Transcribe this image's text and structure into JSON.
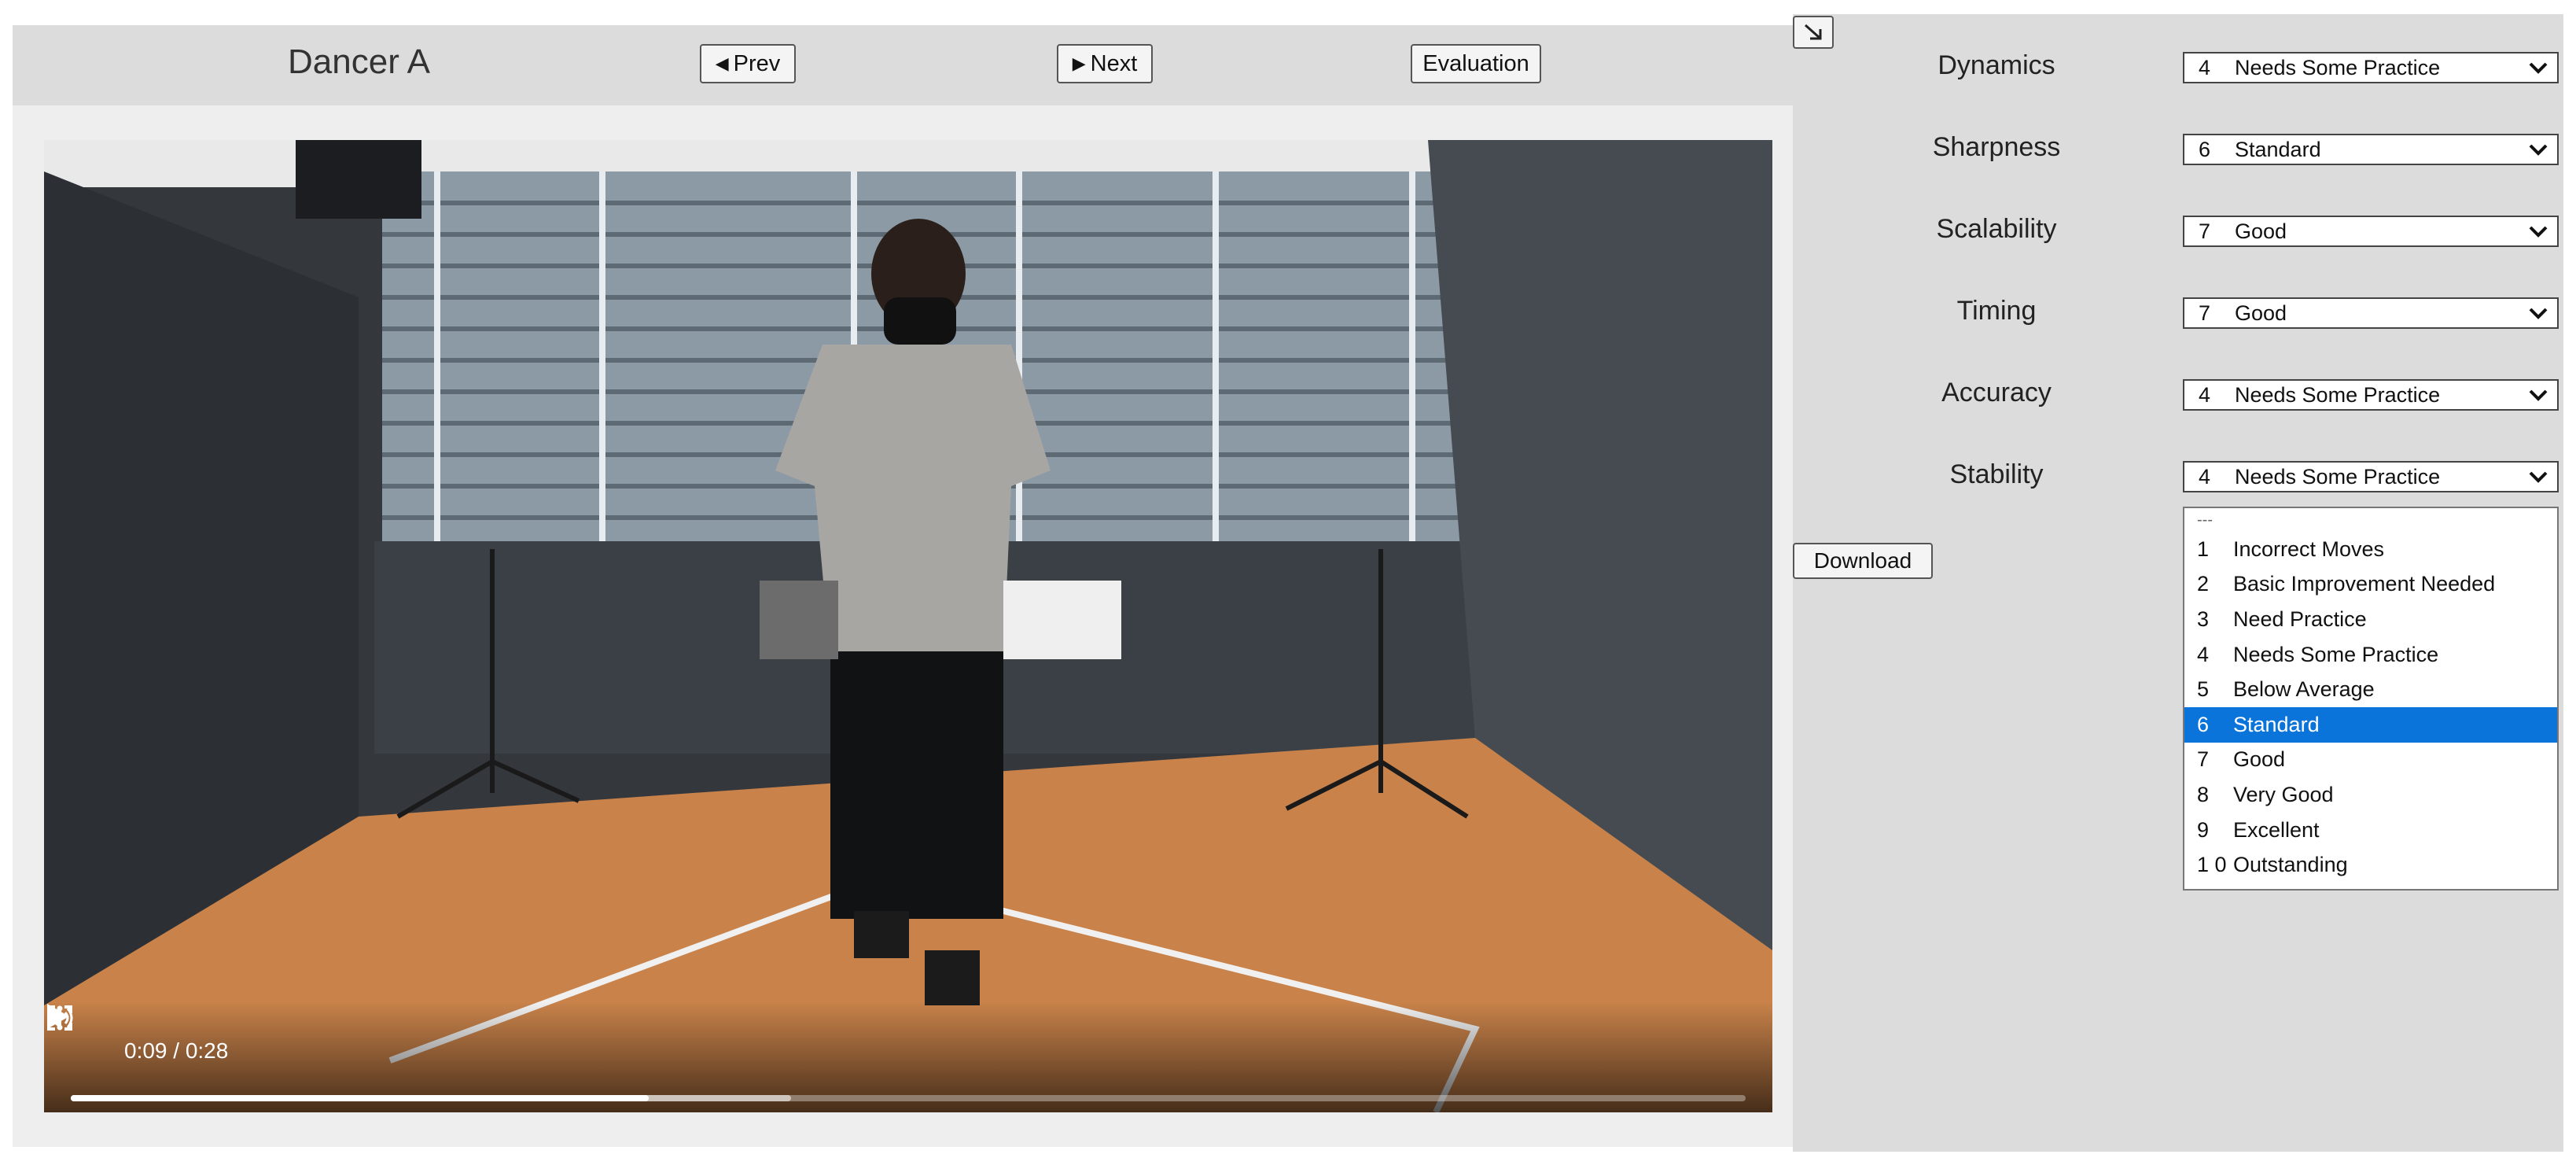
{
  "header": {
    "title": "Dancer A",
    "prev_label": "Prev",
    "next_label": "Next",
    "evaluation_label": "Evaluation"
  },
  "video": {
    "time_display": "0:09 / 0:28",
    "progress_played": 0.345,
    "progress_buffered": 0.43
  },
  "evaluation": {
    "criteria": [
      {
        "label": "Dynamics",
        "score": "4",
        "rating": "Needs Some Practice"
      },
      {
        "label": "Sharpness",
        "score": "6",
        "rating": "Standard"
      },
      {
        "label": "Scalability",
        "score": "7",
        "rating": "Good"
      },
      {
        "label": "Timing",
        "score": "7",
        "rating": "Good"
      },
      {
        "label": "Accuracy",
        "score": "4",
        "rating": "Needs Some Practice"
      },
      {
        "label": "Stability",
        "score": "4",
        "rating": "Needs Some Practice"
      }
    ],
    "download_label": "Download",
    "dropdown": {
      "placeholder": "---",
      "options": [
        {
          "num": "1",
          "label": "Incorrect Moves"
        },
        {
          "num": "2",
          "label": "Basic Improvement Needed"
        },
        {
          "num": "3",
          "label": "Need Practice"
        },
        {
          "num": "4",
          "label": "Needs Some Practice"
        },
        {
          "num": "5",
          "label": "Below Average"
        },
        {
          "num": "6",
          "label": "Standard"
        },
        {
          "num": "7",
          "label": "Good"
        },
        {
          "num": "8",
          "label": "Very Good"
        },
        {
          "num": "9",
          "label": "Excellent"
        },
        {
          "num": "1 0",
          "label": "Outstanding"
        }
      ],
      "highlighted_index": 5
    }
  },
  "colors": {
    "highlight": "#0a74da",
    "panel_bg": "#dcdcdc",
    "floor": "#c8824a",
    "wall": "#3a3f45"
  },
  "icons": {
    "prev": "triangle-left-icon",
    "next": "triangle-right-icon",
    "collapse": "arrow-down-right-icon",
    "play": "play-icon",
    "volume": "volume-icon",
    "fullscreen": "fullscreen-icon",
    "more": "more-vertical-icon",
    "select": "chevron-down-icon"
  }
}
